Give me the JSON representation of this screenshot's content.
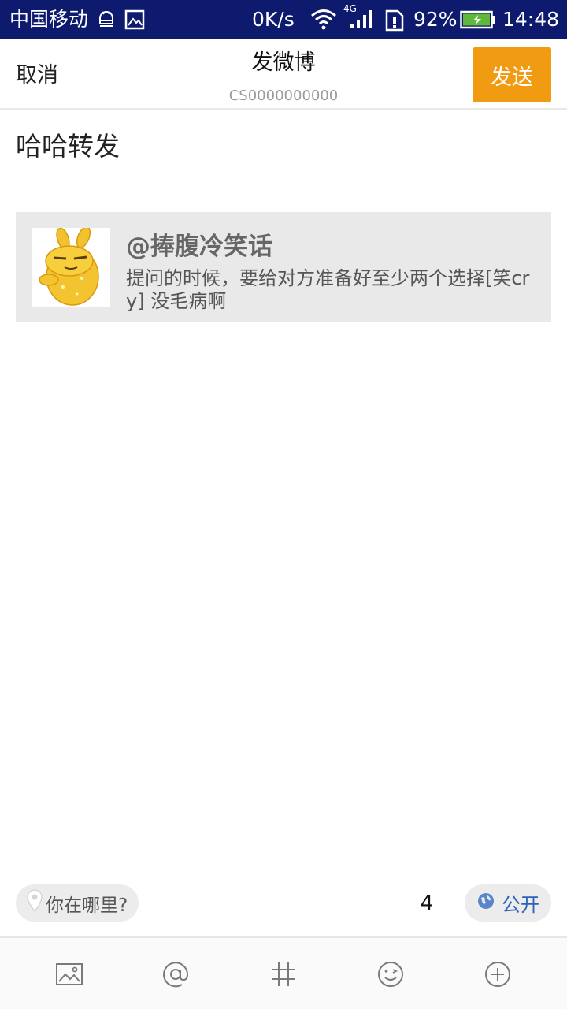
{
  "status_bar": {
    "carrier": "中国移动",
    "net_speed": "0K/s",
    "network_type": "4G",
    "battery_percent": "92%",
    "time": "14:48",
    "icons": [
      "android-debug-icon",
      "image-notify-icon",
      "wifi-icon",
      "signal-icon",
      "sim-alert-icon",
      "battery-charging-icon"
    ]
  },
  "header": {
    "cancel_label": "取消",
    "title": "发微博",
    "subtitle": "CS0000000000",
    "send_label": "发送",
    "send_color": "#f19b12"
  },
  "compose": {
    "text": "哈哈转发"
  },
  "quoted_post": {
    "author": "@捧腹冷笑话",
    "text": "提问的时候，要给对方准备好至少两个选择[笑cry] 没毛病啊",
    "avatar_icon": "cartoon-rabbit-avatar"
  },
  "bottom_bar": {
    "location_placeholder": "你在哪里?",
    "char_count": "4",
    "visibility_label": "公开",
    "visibility_color": "#2a63b8"
  },
  "toolbar": {
    "items": [
      "image-icon",
      "at-mention-icon",
      "hashtag-icon",
      "emoji-icon",
      "add-icon"
    ]
  }
}
